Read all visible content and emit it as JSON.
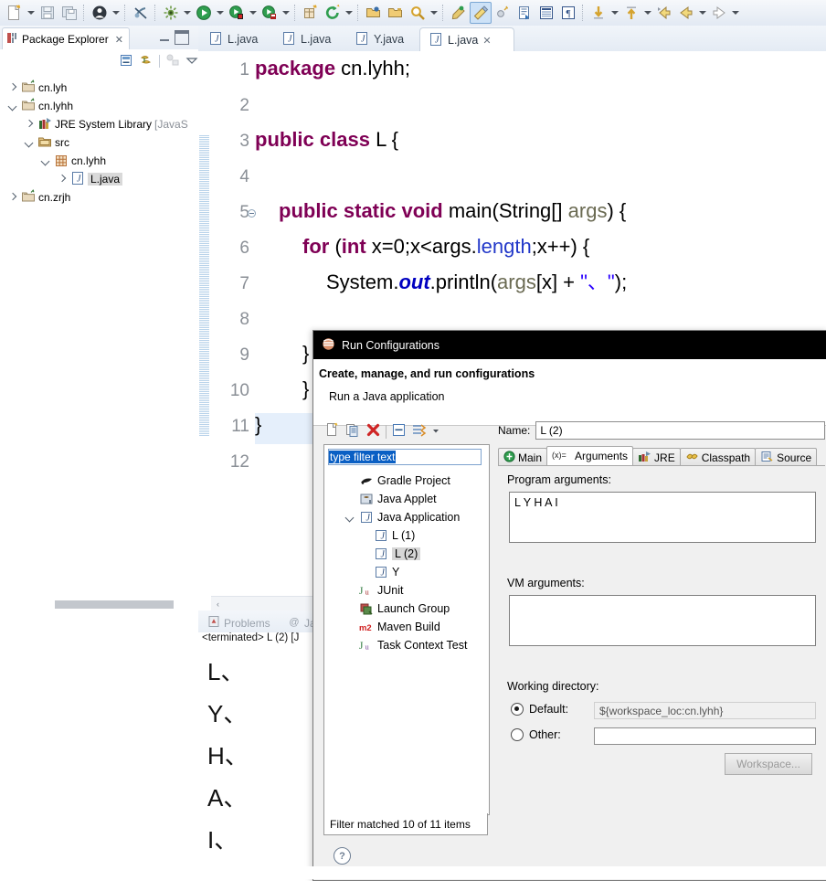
{
  "toolbar": {
    "items": [
      {
        "name": "new-icon",
        "glyph": "new"
      },
      {
        "name": "new-dropdown-arrow",
        "glyph": "arrow"
      },
      {
        "name": "save-icon",
        "glyph": "save"
      },
      {
        "name": "save-all-icon",
        "glyph": "saveall"
      },
      {
        "name": "sep",
        "glyph": "sep"
      },
      {
        "name": "person-icon",
        "glyph": "person"
      },
      {
        "name": "person-dropdown-arrow",
        "glyph": "arrow"
      },
      {
        "name": "sep",
        "glyph": "sep"
      },
      {
        "name": "disabled-link-icon",
        "glyph": "link"
      },
      {
        "name": "sep",
        "glyph": "sep"
      },
      {
        "name": "debug-icon",
        "glyph": "bug"
      },
      {
        "name": "debug-dropdown-arrow",
        "glyph": "arrow"
      },
      {
        "name": "run-icon",
        "glyph": "run"
      },
      {
        "name": "run-dropdown-arrow",
        "glyph": "arrow"
      },
      {
        "name": "run-external-tools-icon",
        "glyph": "runext"
      },
      {
        "name": "run-external-dropdown-arrow",
        "glyph": "arrow"
      },
      {
        "name": "coverage-icon",
        "glyph": "cover"
      },
      {
        "name": "coverage-dropdown-arrow",
        "glyph": "arrow"
      },
      {
        "name": "sep",
        "glyph": "sep"
      },
      {
        "name": "new-package-icon",
        "glyph": "pkg"
      },
      {
        "name": "refresh-icon",
        "glyph": "refresh"
      },
      {
        "name": "refresh-dropdown-arrow",
        "glyph": "arrow"
      },
      {
        "name": "sep",
        "glyph": "sep"
      },
      {
        "name": "open-type-icon",
        "glyph": "opentype"
      },
      {
        "name": "open-resource-icon",
        "glyph": "openres"
      },
      {
        "name": "search-icon",
        "glyph": "search"
      },
      {
        "name": "search-dropdown-arrow",
        "glyph": "arrow"
      },
      {
        "name": "sep",
        "glyph": "sep"
      },
      {
        "name": "annotation-icon",
        "glyph": "annot"
      },
      {
        "name": "pencil-icon",
        "glyph": "pencil"
      },
      {
        "name": "toggle-mark-icon",
        "glyph": "togglemark"
      },
      {
        "name": "next-annotation-icon",
        "glyph": "nextannot"
      },
      {
        "name": "outline-icon",
        "glyph": "outline"
      },
      {
        "name": "paragraph-icon",
        "glyph": "para"
      },
      {
        "name": "sep",
        "glyph": "sep"
      },
      {
        "name": "next-annotation-down-icon",
        "glyph": "downarrow"
      },
      {
        "name": "next-annotation-dropdown-arrow",
        "glyph": "arrow"
      },
      {
        "name": "prev-annotation-up-icon",
        "glyph": "uparrow"
      },
      {
        "name": "prev-annotation-dropdown-arrow",
        "glyph": "arrow"
      },
      {
        "name": "back-history-icon",
        "glyph": "backhist"
      },
      {
        "name": "back-icon",
        "glyph": "back"
      },
      {
        "name": "back-dropdown-arrow",
        "glyph": "arrow"
      },
      {
        "name": "forward-icon",
        "glyph": "forward"
      },
      {
        "name": "forward-dropdown-arrow",
        "glyph": "arrow"
      }
    ]
  },
  "package_explorer": {
    "title": "Package Explorer",
    "close_glyph": "✕",
    "toolbar": [
      {
        "name": "collapse-all-icon"
      },
      {
        "name": "link-with-editor-icon"
      },
      {
        "name": "focus-on-active-task-icon"
      },
      {
        "name": "view-menu-icon"
      }
    ],
    "tree": [
      {
        "label": "cn.lyh",
        "icon": "project-closed-icon",
        "indent": 0,
        "twisty": "right"
      },
      {
        "label": "cn.lyhh",
        "icon": "project-open-icon",
        "indent": 0,
        "twisty": "down"
      },
      {
        "label": "JRE System Library",
        "suffix": "[JavaS",
        "icon": "library-icon",
        "indent": 1,
        "twisty": "right"
      },
      {
        "label": "src",
        "icon": "source-folder-icon",
        "indent": 1,
        "twisty": "down"
      },
      {
        "label": "cn.lyhh",
        "icon": "package-icon",
        "indent": 2,
        "twisty": "down"
      },
      {
        "label": "L.java",
        "icon": "java-file-icon",
        "indent": 3,
        "twisty": "right",
        "selected": true
      },
      {
        "label": "cn.zrjh",
        "icon": "project-closed-icon",
        "indent": 0,
        "twisty": "right"
      }
    ]
  },
  "editor": {
    "tabs": [
      {
        "label": "L.java",
        "active": false,
        "icon": "java-file-icon"
      },
      {
        "label": "L.java",
        "active": false,
        "icon": "java-file-icon"
      },
      {
        "label": "Y.java",
        "active": false,
        "icon": "java-file-icon"
      },
      {
        "label": "L.java",
        "active": true,
        "icon": "java-file-icon",
        "close_glyph": "✕"
      }
    ],
    "current_line": 11,
    "lines": [
      {
        "n": "1",
        "fold": false,
        "indent": 0,
        "tokens": [
          {
            "t": "package ",
            "c": "kw"
          },
          {
            "t": "cn.lyhh;",
            "c": "pl"
          }
        ]
      },
      {
        "n": "2",
        "fold": false,
        "indent": 0,
        "tokens": []
      },
      {
        "n": "3",
        "fold": false,
        "indent": 0,
        "tokens": [
          {
            "t": "public class ",
            "c": "kw"
          },
          {
            "t": "L ",
            "c": "pl"
          },
          {
            "t": "{",
            "c": "pl"
          }
        ]
      },
      {
        "n": "4",
        "fold": false,
        "indent": 0,
        "tokens": []
      },
      {
        "n": "5",
        "fold": true,
        "indent": 1,
        "tokens": [
          {
            "t": "public static void ",
            "c": "kw"
          },
          {
            "t": "main(String[] ",
            "c": "pl"
          },
          {
            "t": "args",
            "c": "param"
          },
          {
            "t": ") {",
            "c": "pl"
          }
        ]
      },
      {
        "n": "6",
        "fold": false,
        "indent": 2,
        "tokens": [
          {
            "t": "for ",
            "c": "kw"
          },
          {
            "t": "(",
            "c": "pl"
          },
          {
            "t": "int ",
            "c": "kw"
          },
          {
            "t": "x=0;x<args.",
            "c": "pl"
          },
          {
            "t": "length",
            "c": "blu"
          },
          {
            "t": ";x++) {",
            "c": "pl"
          }
        ]
      },
      {
        "n": "7",
        "fold": false,
        "indent": 3,
        "tokens": [
          {
            "t": "System.",
            "c": "pl"
          },
          {
            "t": "out",
            "c": "fld"
          },
          {
            "t": ".println(",
            "c": "pl"
          },
          {
            "t": "args",
            "c": "param"
          },
          {
            "t": "[x] + ",
            "c": "pl"
          },
          {
            "t": "\"、\"",
            "c": "strq"
          },
          {
            "t": ");",
            "c": "pl"
          }
        ]
      },
      {
        "n": "8",
        "fold": false,
        "indent": 0,
        "tokens": []
      },
      {
        "n": "9",
        "fold": false,
        "indent": 2,
        "tokens": [
          {
            "t": "}",
            "c": "pl"
          }
        ]
      },
      {
        "n": "10",
        "fold": false,
        "indent": 2,
        "tokens": [
          {
            "t": "}",
            "c": "pl"
          }
        ]
      },
      {
        "n": "11",
        "fold": false,
        "indent": 0,
        "tokens": [
          {
            "t": "}",
            "c": "pl"
          }
        ]
      },
      {
        "n": "12",
        "fold": false,
        "indent": 0,
        "tokens": []
      }
    ],
    "hscroll_left_glyph": "‹"
  },
  "console": {
    "tabs": [
      {
        "label": "Problems",
        "icon": "problems-icon"
      },
      {
        "label": "Jav",
        "icon": "javadoc-icon"
      }
    ],
    "status": "<terminated> L (2) [J",
    "output": [
      "L、",
      "Y、",
      "H、",
      "A、",
      "I、"
    ]
  },
  "dialog": {
    "title": "Run Configurations",
    "title_icon": "eclipse-icon",
    "heading": "Create, manage, and run configurations",
    "subheading": "Run a Java application",
    "left_toolbar": [
      {
        "name": "new-launch-configuration-icon"
      },
      {
        "name": "duplicate-icon"
      },
      {
        "name": "delete-icon"
      },
      {
        "name": "collapse-all-icon"
      },
      {
        "name": "filter-icon"
      },
      {
        "name": "filter-dropdown-arrow"
      }
    ],
    "filter": {
      "value": "type filter text",
      "placeholder": "type filter text"
    },
    "config_tree": [
      {
        "label": "Gradle Project",
        "icon": "gradle-icon",
        "indent": 1,
        "twisty": "none"
      },
      {
        "label": "Java Applet",
        "icon": "java-applet-icon",
        "indent": 1,
        "twisty": "none"
      },
      {
        "label": "Java Application",
        "icon": "java-application-icon",
        "indent": 1,
        "twisty": "down"
      },
      {
        "label": "L (1)",
        "icon": "launch-config-icon",
        "indent": 2,
        "twisty": "none"
      },
      {
        "label": "L (2)",
        "icon": "launch-config-icon",
        "indent": 2,
        "twisty": "none",
        "selected": true
      },
      {
        "label": "Y",
        "icon": "launch-config-icon",
        "indent": 2,
        "twisty": "none"
      },
      {
        "label": "JUnit",
        "icon": "junit-icon",
        "indent": 1,
        "twisty": "none"
      },
      {
        "label": "Launch Group",
        "icon": "launch-group-icon",
        "indent": 1,
        "twisty": "none"
      },
      {
        "label": "Maven Build",
        "icon": "maven-icon",
        "indent": 1,
        "twisty": "none"
      },
      {
        "label": "Task Context Test",
        "icon": "task-context-icon",
        "indent": 1,
        "twisty": "none"
      }
    ],
    "filter_status": "Filter matched 10 of 11 items",
    "name_label": "Name:",
    "name_value": "L (2)",
    "tabs": [
      {
        "label": "Main",
        "icon": "main-tab-icon",
        "active": false
      },
      {
        "label": "Arguments",
        "icon": "arguments-tab-icon",
        "active": true
      },
      {
        "label": "JRE",
        "icon": "jre-tab-icon",
        "active": false
      },
      {
        "label": "Classpath",
        "icon": "classpath-tab-icon",
        "active": false
      },
      {
        "label": "Source",
        "icon": "source-tab-icon",
        "active": false
      }
    ],
    "program_arguments_label": "Program arguments:",
    "program_arguments_value": "L Y H A I",
    "vm_arguments_label": "VM arguments:",
    "vm_arguments_value": "",
    "working_directory_label": "Working directory:",
    "default_radio_label": "Default:",
    "default_radio_checked": true,
    "default_path": "${workspace_loc:cn.lyhh}",
    "other_radio_label": "Other:",
    "other_radio_checked": false,
    "other_path": "",
    "workspace_button": "Workspace...",
    "help_glyph": "?"
  },
  "colors": {
    "keyword": "#7f0055",
    "field": "#0000c0",
    "string": "#2a00ff",
    "parameter": "#6a6a52",
    "current_line": "#e5effb",
    "selection": "#d6d6d6",
    "dialog_title_bg": "#000000",
    "filter_highlight": "#0a5fc4"
  }
}
